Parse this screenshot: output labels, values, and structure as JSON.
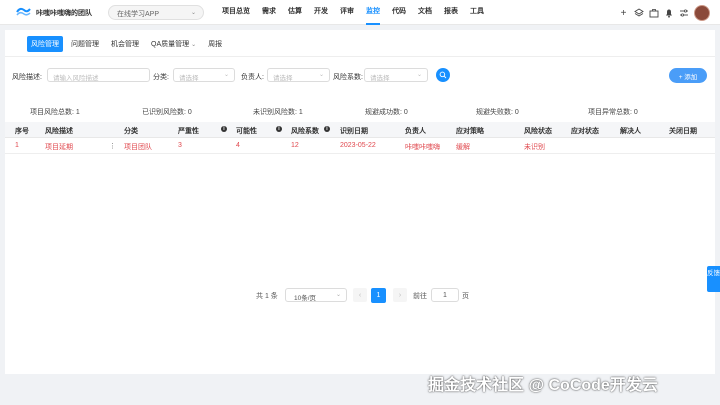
{
  "header": {
    "team_name": "咔嗤咔嗤嗨的团队",
    "app_select": "在线学习APP",
    "nav": [
      "项目总览",
      "需求",
      "估算",
      "开发",
      "评审",
      "监控",
      "代码",
      "文档",
      "报表",
      "工具"
    ],
    "icons": [
      "plus-icon",
      "layers-icon",
      "briefcase-icon",
      "bell-icon",
      "sliders-icon",
      "avatar"
    ]
  },
  "subtabs": [
    {
      "label": "风险管理",
      "active": true
    },
    {
      "label": "问题管理",
      "active": false
    },
    {
      "label": "机会管理",
      "active": false
    },
    {
      "label": "QA质量管理",
      "active": false,
      "dropdown": true
    },
    {
      "label": "周报",
      "active": false
    }
  ],
  "filters": {
    "desc_label": "风险描述:",
    "desc_placeholder": "请输入风险描述",
    "category_label": "分类:",
    "category_placeholder": "请选择",
    "owner_label": "负责人:",
    "owner_placeholder": "请选择",
    "coef_label": "风险系数:",
    "coef_placeholder": "请选择",
    "add_button": "+ 添加"
  },
  "stats": [
    "项目风险总数:  1",
    "已识别风险数:  0",
    "未识别风险数:  1",
    "规避成功数:  0",
    "规避失败数:  0",
    "项目异常总数:  0"
  ],
  "table": {
    "headers": [
      "序号",
      "风险描述",
      "分类",
      "严重性",
      "可能性",
      "风险系数",
      "识别日期",
      "负责人",
      "应对策略",
      "风险状态",
      "应对状态",
      "解决人",
      "关闭日期"
    ],
    "rows": [
      {
        "index": "1",
        "desc": "项目延期",
        "category": "项目团队",
        "severity": "3",
        "probability": "4",
        "coef": "12",
        "date": "2023-05-22",
        "owner": "咔嗤咔嗤嗨",
        "strategy": "缓解",
        "risk_status": "未识别"
      }
    ]
  },
  "pagination": {
    "total": "共 1 条",
    "page_size": "10条/页",
    "current": "1",
    "goto_label": "前往",
    "goto_value": "1",
    "page_suffix": "页"
  },
  "feedback": "反馈",
  "watermark": "掘金技术社区 @ CoCode开发云",
  "colors": {
    "accent": "#1890ff",
    "row_text": "#e0484e"
  }
}
